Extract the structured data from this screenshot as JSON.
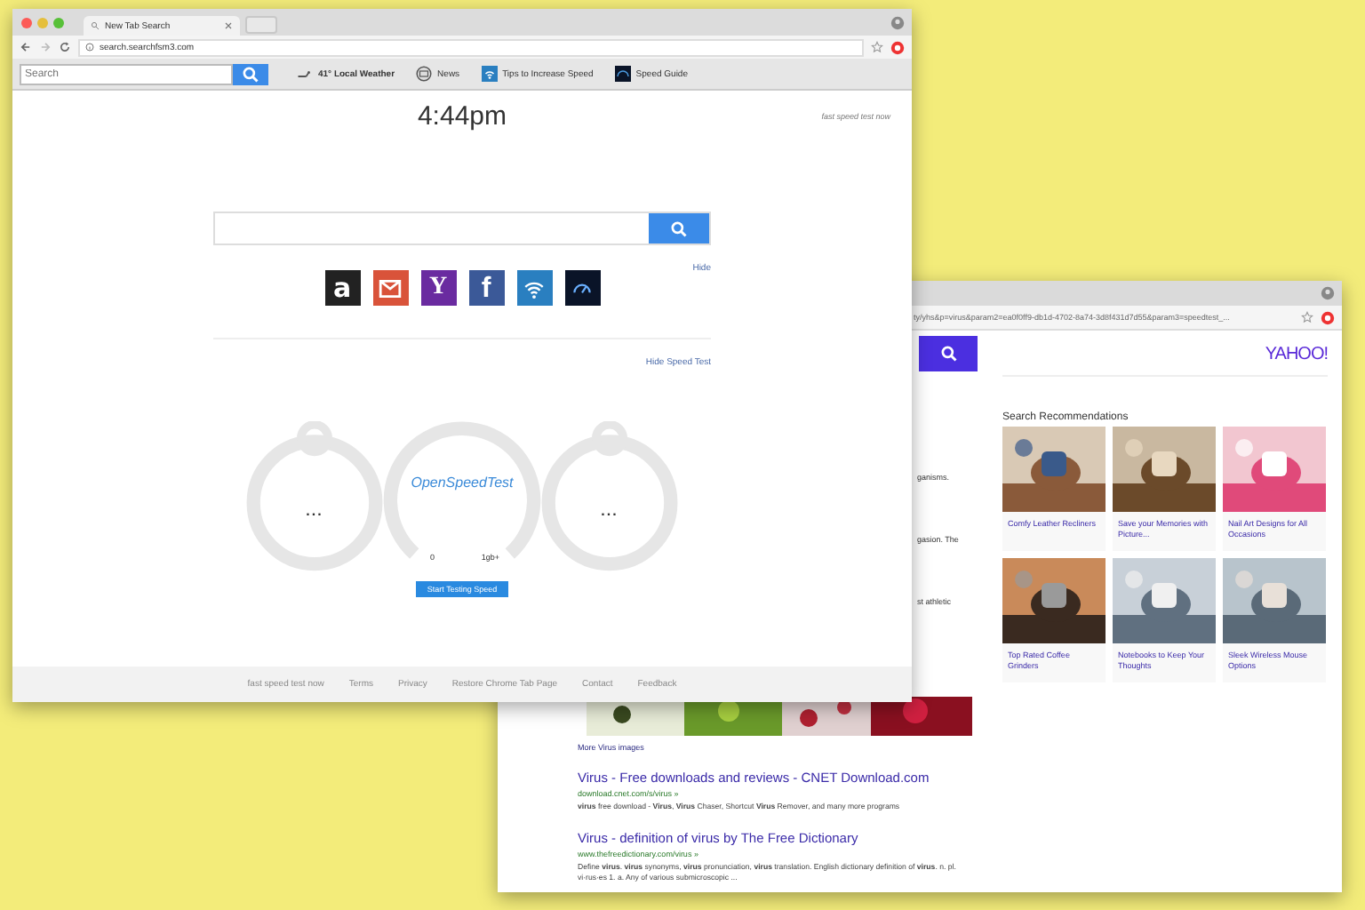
{
  "back_window": {
    "address": "ty/yhs&p=virus&param2=ea0f0ff9-db1d-4702-8a74-3d8f431d7d55&param3=speedtest_...",
    "logo": "YAHOO!",
    "fragments": [
      "ganisms.",
      "gasion. The",
      "st athletic"
    ],
    "recommendations": {
      "title": "Search Recommendations",
      "cards": [
        {
          "caption": "Comfy Leather Recliners"
        },
        {
          "caption": "Save your Memories with Picture..."
        },
        {
          "caption": "Nail Art Designs for All Occasions"
        },
        {
          "caption": "Top Rated Coffee Grinders"
        },
        {
          "caption": "Notebooks to Keep Your Thoughts"
        },
        {
          "caption": "Sleek Wireless Mouse Options"
        }
      ]
    },
    "more_images": "More Virus images",
    "results": [
      {
        "title": "Virus - Free downloads and reviews - CNET Download.com",
        "url": "download.cnet.com/s/virus »",
        "snippet": "**virus** free download - **Virus**, **Virus** Chaser, Shortcut **Virus** Remover, and many more programs"
      },
      {
        "title": "Virus - definition of virus by The Free Dictionary",
        "url": "www.thefreedictionary.com/virus »",
        "snippet": "Define **virus**. **virus** synonyms, **virus** pronunciation, **virus** translation. English dictionary definition of **virus**. n. pl. vi·rus·es 1. a. Any of various submicroscopic ..."
      }
    ]
  },
  "front_window": {
    "tab": {
      "title": "New Tab Search"
    },
    "address": "search.searchfsm3.com",
    "toolbar": {
      "search_placeholder": "Search",
      "links": [
        {
          "kind": "weather",
          "label": "41° Local Weather"
        },
        {
          "kind": "news",
          "label": "News"
        },
        {
          "kind": "wifi",
          "label": "Tips to Increase Speed"
        },
        {
          "kind": "guide",
          "label": "Speed Guide"
        }
      ]
    },
    "clock": "4:44pm",
    "corner_link": "fast speed test now",
    "hide_link": "Hide",
    "shortcuts": [
      {
        "kind": "amazon",
        "label": "a"
      },
      {
        "kind": "mail"
      },
      {
        "kind": "yahoo",
        "label": "Y"
      },
      {
        "kind": "facebook",
        "label": "f"
      },
      {
        "kind": "wifi"
      },
      {
        "kind": "speed"
      }
    ],
    "hide_speed_test": "Hide Speed Test",
    "speed_test": {
      "left_reading": "...",
      "logo": "OpenSpeedTest",
      "scale_min": "0",
      "scale_max": "1gb+",
      "right_reading": "...",
      "button": "Start Testing Speed"
    },
    "footer": [
      "fast speed test now",
      "Terms",
      "Privacy",
      "Restore Chrome Tab Page",
      "Contact",
      "Feedback"
    ]
  }
}
